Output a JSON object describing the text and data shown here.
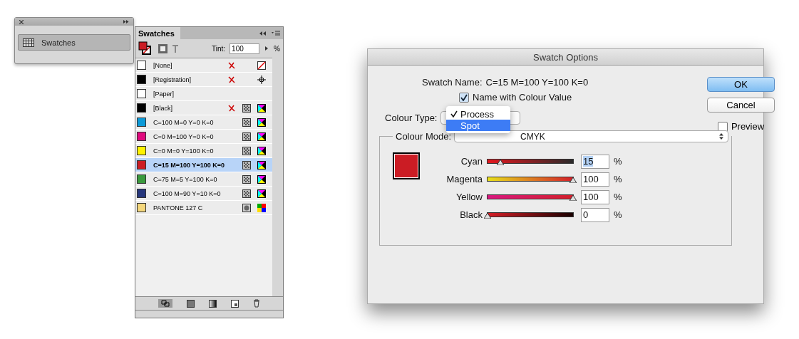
{
  "collapsed_panel": {
    "item": "Swatches"
  },
  "swatches_panel": {
    "tab": "Swatches",
    "tint_label": "Tint:",
    "tint_value": "100",
    "tint_unit": "%",
    "swatches": [
      {
        "name": "[None]",
        "kind": "none",
        "color": "#ffffff",
        "selected": false
      },
      {
        "name": "[Registration]",
        "kind": "registration",
        "color": "#000000",
        "selected": false
      },
      {
        "name": "[Paper]",
        "kind": "paper",
        "color": "#ffffff",
        "selected": false
      },
      {
        "name": "[Black]",
        "kind": "black",
        "color": "#000000",
        "selected": false
      },
      {
        "name": "C=100 M=0 Y=0 K=0",
        "kind": "process",
        "color": "#0c9ad8",
        "selected": false
      },
      {
        "name": "C=0 M=100 Y=0 K=0",
        "kind": "process",
        "color": "#e0097e",
        "selected": false
      },
      {
        "name": "C=0 M=0 Y=100 K=0",
        "kind": "process",
        "color": "#fff200",
        "selected": false
      },
      {
        "name": "C=15 M=100 Y=100 K=0",
        "kind": "process",
        "color": "#cb1c24",
        "selected": true
      },
      {
        "name": "C=75 M=5 Y=100 K=0",
        "kind": "process",
        "color": "#3a9a3d",
        "selected": false
      },
      {
        "name": "C=100 M=90 Y=10 K=0",
        "kind": "process",
        "color": "#25367c",
        "selected": false
      },
      {
        "name": "PANTONE 127 C",
        "kind": "spot",
        "color": "#f4d77c",
        "selected": false
      }
    ]
  },
  "dialog": {
    "title": "Swatch Options",
    "swatch_name_label": "Swatch Name:",
    "swatch_name": "C=15 M=100 Y=100 K=0",
    "name_with_value": {
      "label": "Name with Colour Value",
      "checked": true
    },
    "colour_type_label": "Colour Type:",
    "colour_type_menu": [
      {
        "label": "Process",
        "checked": true,
        "selected": false
      },
      {
        "label": "Spot",
        "checked": false,
        "selected": true
      }
    ],
    "colour_mode_label": "Colour Mode:",
    "colour_mode": "CMYK",
    "channels": [
      {
        "name": "Cyan",
        "level": 0.15,
        "value": "15",
        "unit": "%",
        "selected": true
      },
      {
        "name": "Magenta",
        "level": 1,
        "value": "100",
        "unit": "%",
        "selected": false
      },
      {
        "name": "Yellow",
        "level": 1,
        "value": "100",
        "unit": "%",
        "selected": false
      },
      {
        "name": "Black",
        "level": 0,
        "value": "0",
        "unit": "%",
        "selected": false
      }
    ],
    "buttons": [
      {
        "label": "OK",
        "default": true
      },
      {
        "label": "Cancel",
        "default": false
      }
    ],
    "preview": {
      "label": "Preview",
      "checked": false
    }
  }
}
